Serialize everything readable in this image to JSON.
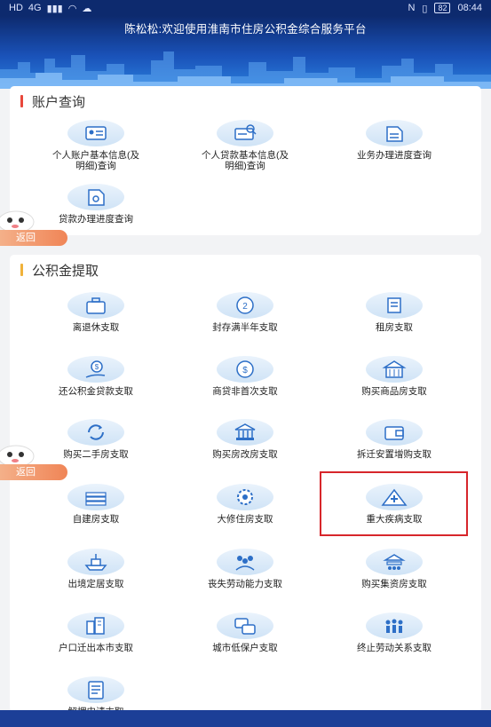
{
  "status": {
    "left_icons": [
      "HD",
      "4G",
      "signal",
      "wifi",
      "cloud"
    ],
    "battery": "82",
    "time": "08:44"
  },
  "header": {
    "greeting": "陈松松:欢迎使用淮南市住房公积金综合服务平台"
  },
  "colors": {
    "account_bar": "#e8483b",
    "withdraw_bar": "#f0b23a",
    "highlight": "#d7262b"
  },
  "account_section": {
    "title": "账户查询",
    "items": [
      {
        "label_line1": "个人账户基本信息(及",
        "label_line2": "明细)查询",
        "icon": "id-card-icon"
      },
      {
        "label_line1": "个人贷款基本信息(及",
        "label_line2": "明细)查询",
        "icon": "loan-search-icon"
      },
      {
        "label_line1": "业务办理进度查询",
        "label_line2": "",
        "icon": "document-icon"
      },
      {
        "label_line1": "贷款办理进度查询",
        "label_line2": "",
        "icon": "loan-doc-icon"
      }
    ]
  },
  "withdraw_section": {
    "title": "公积金提取",
    "items": [
      {
        "label": "离退休支取",
        "icon": "briefcase-icon"
      },
      {
        "label": "封存满半年支取",
        "icon": "clock-icon"
      },
      {
        "label": "租房支取",
        "icon": "scroll-icon"
      },
      {
        "label": "还公积金贷款支取",
        "icon": "money-hand-icon"
      },
      {
        "label": "商贷非首次支取",
        "icon": "coin-icon"
      },
      {
        "label": "购买商品房支取",
        "icon": "building-icon"
      },
      {
        "label": "购买二手房支取",
        "icon": "refresh-icon"
      },
      {
        "label": "购买房改房支取",
        "icon": "bank-icon"
      },
      {
        "label": "拆迁安置增购支取",
        "icon": "wallet-icon"
      },
      {
        "label": "自建房支取",
        "icon": "cash-stack-icon"
      },
      {
        "label": "大修住房支取",
        "icon": "gear-icon"
      },
      {
        "label": "重大疾病支取",
        "icon": "medical-icon"
      },
      {
        "label": "出境定居支取",
        "icon": "ship-icon"
      },
      {
        "label": "丧失劳动能力支取",
        "icon": "group-icon"
      },
      {
        "label": "购买集资房支取",
        "icon": "pavilion-icon"
      },
      {
        "label": "户口迁出本市支取",
        "icon": "city-icon"
      },
      {
        "label": "城市低保户支取",
        "icon": "chat-icon"
      },
      {
        "label": "终止劳动关系支取",
        "icon": "people-icon"
      },
      {
        "label": "解押申请支取",
        "icon": "form-icon"
      }
    ]
  },
  "floating": {
    "back_label": "返回"
  }
}
